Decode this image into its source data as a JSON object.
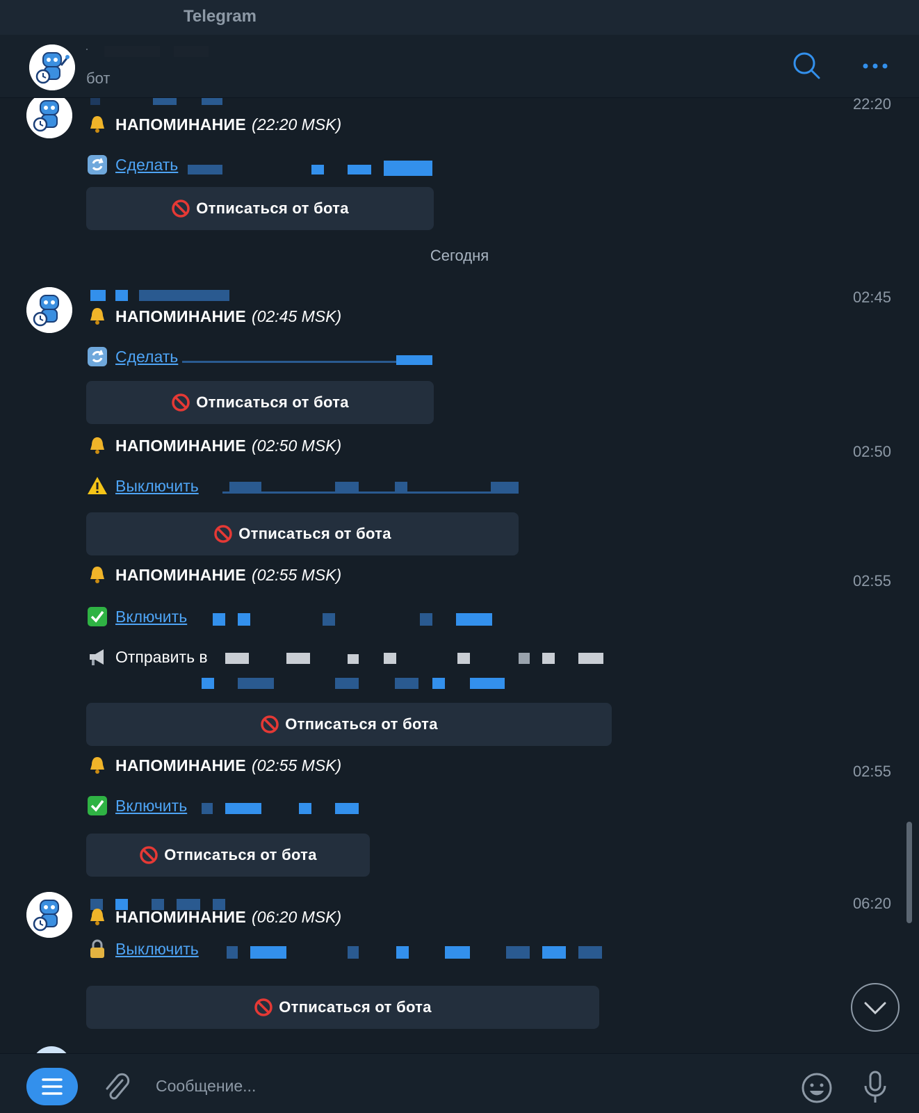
{
  "window": {
    "title": "Telegram"
  },
  "header": {
    "chat_subtitle": "бот"
  },
  "date_separator": "Сегодня",
  "messages": [
    {
      "time": "22:20",
      "reminder_label": "НАПОМИНАНИЕ",
      "reminder_time": "(22:20 MSK)",
      "action_link": "Сделать",
      "unsubscribe": "Отписаться от бота"
    },
    {
      "time": "02:45",
      "reminder_label": "НАПОМИНАНИЕ",
      "reminder_time": "(02:45 MSK)",
      "action_link": "Сделать",
      "unsubscribe": "Отписаться от бота"
    },
    {
      "time": "02:50",
      "reminder_label": "НАПОМИНАНИЕ",
      "reminder_time": "(02:50 MSK)",
      "action_link": "Выключить",
      "unsubscribe": "Отписаться от бота"
    },
    {
      "time": "02:55",
      "reminder_label": "НАПОМИНАНИЕ",
      "reminder_time": "(02:55 MSK)",
      "action_link": "Включить",
      "send_text": "Отправить в",
      "unsubscribe": "Отписаться от бота"
    },
    {
      "time": "02:55",
      "reminder_label": "НАПОМИНАНИЕ",
      "reminder_time": "(02:55 MSK)",
      "action_link": "Включить",
      "unsubscribe": "Отписаться от бота"
    },
    {
      "time": "06:20",
      "reminder_label": "НАПОМИНАНИЕ",
      "reminder_time": "(06:20 MSK)",
      "action_link": "Выключить",
      "unsubscribe": "Отписаться от бота"
    }
  ],
  "composer": {
    "placeholder": "Сообщение..."
  },
  "icons": {
    "bell": "bell-icon",
    "refresh": "refresh-icon",
    "warning": "warning-icon",
    "check": "check-icon",
    "megaphone": "megaphone-icon",
    "lock": "lock-icon",
    "prohibited": "prohibited-icon"
  },
  "colors": {
    "background": "#151e27",
    "header": "#17212b",
    "accent": "#3390ec",
    "link": "#4ea4f5",
    "button": "#232f3d",
    "secondary_text": "#8d99a6"
  }
}
